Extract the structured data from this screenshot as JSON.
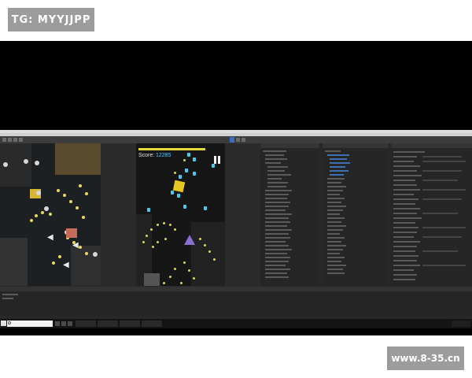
{
  "watermarks": {
    "top_left": "TG: MYYJJPP",
    "bottom_right": "www.8-35.cn"
  },
  "game": {
    "score_label": "Score:",
    "score_value": "12285"
  },
  "colors": {
    "bullet_yellow": "#e2d44c",
    "enemy_blue": "#4cc8ea",
    "player_ship": "#8a6fd0",
    "health_bar": "#e5d83a"
  }
}
